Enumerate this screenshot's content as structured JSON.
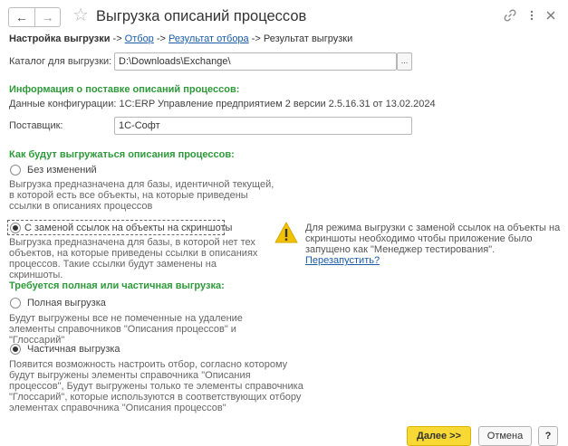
{
  "header": {
    "back_icon": "arrow-left-icon",
    "forward_icon": "arrow-right-icon",
    "favorite_icon": "star-icon",
    "title": "Выгрузка описаний процессов",
    "link_icon": "link-icon",
    "more_icon": "more-vertical-icon",
    "close_icon": "close-icon"
  },
  "breadcrumb": {
    "current": "Настройка выгрузки",
    "sep1": " -> ",
    "step2": "Отбор",
    "sep2": " -> ",
    "step3": "Результат отбора",
    "sep3": " -> ",
    "step4": "Результат выгрузки"
  },
  "catalog": {
    "label": "Каталог для выгрузки:",
    "value": "D:\\Downloads\\Exchange\\",
    "browse_label": "..."
  },
  "delivery": {
    "heading": "Информация о поставке описаний процессов:",
    "config_text": "Данные конфигурации: 1С:ERP Управление предприятием 2 версии 2.5.16.31 от 13.02.2024",
    "supplier_label": "Поставщик:",
    "supplier_value": "1С-Софт"
  },
  "mode": {
    "heading": "Как будут выгружаться описания процессов:",
    "option1_label": "Без изменений",
    "option1_desc": "Выгрузка предназначена для базы, идентичной текущей, в которой есть все объекты, на которые приведены ссылки в описаниях процессов",
    "option2_label": "С заменой ссылок на объекты на скриншоты",
    "option2_desc": "Выгрузка предназначена для базы, в которой нет тех объектов, на которые приведены ссылки в описаниях процессов. Такие ссылки будут заменены на скриншоты.",
    "selected": "option2",
    "warning_icon": "warning-icon",
    "warning_text": "Для режима выгрузки с заменой ссылок на объекты на скриншоты необходимо чтобы приложение было запущено как \"Менеджер тестирования\".",
    "restart_link": "Перезапустить?"
  },
  "scope": {
    "heading": "Требуется полная или частичная выгрузка:",
    "option1_label": "Полная выгрузка",
    "option1_desc": "Будут выгружены все не помеченные на удаление элементы справочников \"Описания процессов\" и \"Глоссарий\"",
    "option2_label": "Частичная выгрузка",
    "option2_desc": "Появится возможность настроить отбор, согласно которому будут выгружены элементы справочника \"Описания процессов\", Будут выгружены только те элементы справочника \"Глоссарий\", которые используются в соответствующих отбору элементах справочника \"Описания процессов\"",
    "selected": "option2"
  },
  "footer": {
    "next_label": "Далее >>",
    "cancel_label": "Отмена",
    "help_label": "?"
  },
  "colors": {
    "section_heading": "#2e9a3a",
    "link": "#1a5ca8",
    "primary_button": "#f7d835",
    "warning": "#f2c200"
  }
}
